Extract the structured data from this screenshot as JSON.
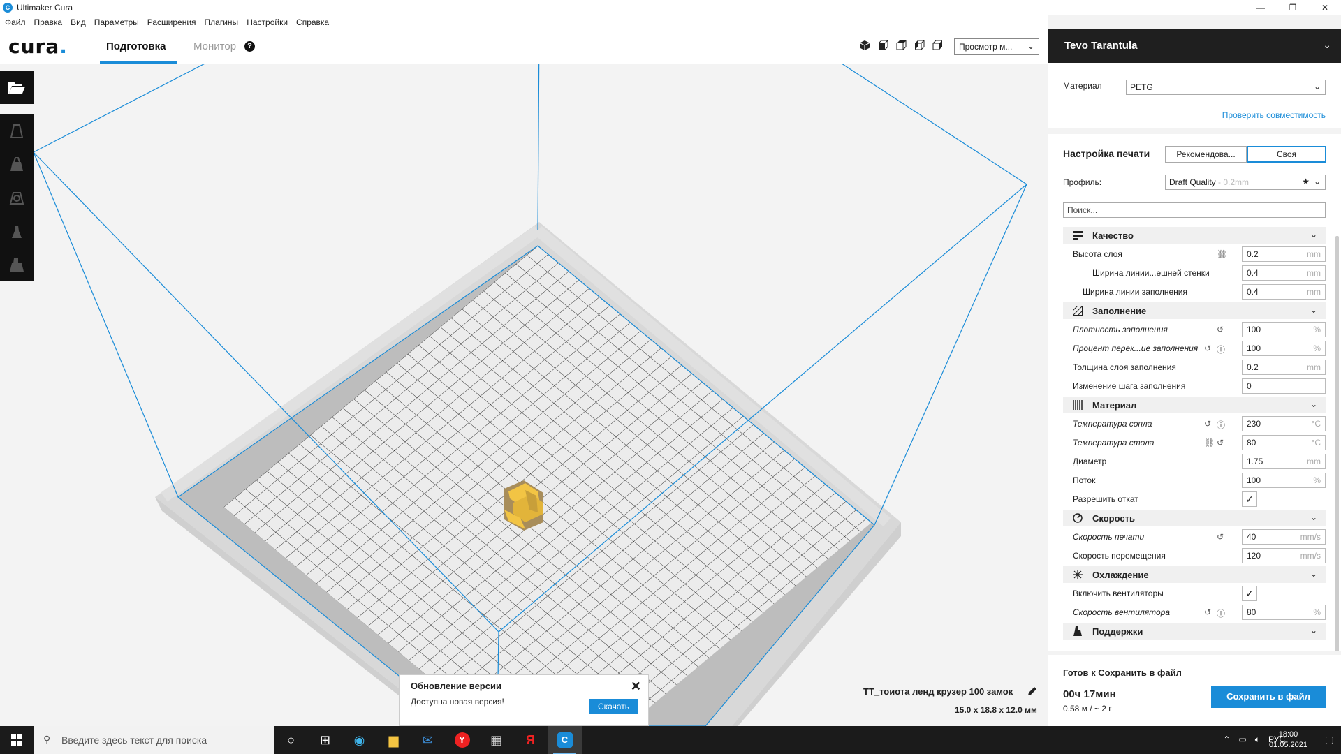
{
  "window": {
    "title": "Ultimaker Cura",
    "minimize": "—",
    "maximize": "❐",
    "close": "✕"
  },
  "menu": [
    "Файл",
    "Правка",
    "Вид",
    "Параметры",
    "Расширения",
    "Плагины",
    "Настройки",
    "Справка"
  ],
  "header": {
    "logo": "cura",
    "logo_dot": ".",
    "tab_prepare": "Подготовка",
    "tab_monitor": "Монитор",
    "help_icon": "?",
    "view_select": "Просмотр м...",
    "view_icons": [
      "3d-view-icon",
      "front-view-icon",
      "top-view-icon",
      "left-view-icon",
      "right-view-icon"
    ]
  },
  "viewport": {
    "object_name": "TT_тоиота ленд крузер 100 замок",
    "object_size": "15.0 x 18.8 x 12.0 мм",
    "model_color": "#f2c444",
    "accent": "#1a8cd8"
  },
  "update": {
    "title": "Обновление версии",
    "body": "Доступна новая версия!",
    "button": "Скачать"
  },
  "panel": {
    "printer": "Tevo Tarantula",
    "material_label": "Материал",
    "material_value": "PETG",
    "compat_link": "Проверить совместимость",
    "print_setup": "Настройка печати",
    "mode_recommended": "Рекомендова...",
    "mode_custom": "Своя",
    "profile_label": "Профиль:",
    "profile_value": "Draft Quality",
    "profile_sub": "- 0.2mm",
    "search_placeholder": "Поиск...",
    "settings": [
      {
        "type": "cat",
        "label": "Качество",
        "icon": "quality-icon"
      },
      {
        "type": "set",
        "label": "Высота слоя",
        "value": "0.2",
        "unit": "mm",
        "indent": 14,
        "italic": false,
        "icons": [
          "link"
        ]
      },
      {
        "type": "set",
        "label": "Ширина линии...ешней стенки",
        "value": "0.4",
        "unit": "mm",
        "indent": 42,
        "italic": false,
        "icons": []
      },
      {
        "type": "set",
        "label": "Ширина линии заполнения",
        "value": "0.4",
        "unit": "mm",
        "indent": 28,
        "italic": false,
        "icons": []
      },
      {
        "type": "cat",
        "label": "Заполнение",
        "icon": "infill-icon"
      },
      {
        "type": "set",
        "label": "Плотность заполнения",
        "value": "100",
        "unit": "%",
        "indent": 14,
        "italic": true,
        "icons": [
          "reset"
        ]
      },
      {
        "type": "set",
        "label": "Процент перек...ие заполнения",
        "value": "100",
        "unit": "%",
        "indent": 14,
        "italic": true,
        "icons": [
          "reset",
          "info"
        ]
      },
      {
        "type": "set",
        "label": "Толщина слоя заполнения",
        "value": "0.2",
        "unit": "mm",
        "indent": 14,
        "italic": false,
        "icons": []
      },
      {
        "type": "set",
        "label": "Изменение шага заполнения",
        "value": "0",
        "unit": "",
        "indent": 14,
        "italic": false,
        "icons": []
      },
      {
        "type": "cat",
        "label": "Материал",
        "icon": "material-icon"
      },
      {
        "type": "set",
        "label": "Температура сопла",
        "value": "230",
        "unit": "°C",
        "indent": 14,
        "italic": true,
        "icons": [
          "reset",
          "info"
        ]
      },
      {
        "type": "set",
        "label": "Температура стола",
        "value": "80",
        "unit": "°C",
        "indent": 14,
        "italic": true,
        "icons": [
          "link",
          "reset"
        ]
      },
      {
        "type": "set",
        "label": "Диаметр",
        "value": "1.75",
        "unit": "mm",
        "indent": 14,
        "italic": false,
        "icons": []
      },
      {
        "type": "set",
        "label": "Поток",
        "value": "100",
        "unit": "%",
        "indent": 14,
        "italic": false,
        "icons": []
      },
      {
        "type": "chk",
        "label": "Разрешить откат",
        "value": "✓",
        "indent": 14,
        "italic": false,
        "icons": []
      },
      {
        "type": "cat",
        "label": "Скорость",
        "icon": "speed-icon"
      },
      {
        "type": "set",
        "label": "Скорость печати",
        "value": "40",
        "unit": "mm/s",
        "indent": 14,
        "italic": true,
        "icons": [
          "reset"
        ]
      },
      {
        "type": "set",
        "label": "Скорость перемещения",
        "value": "120",
        "unit": "mm/s",
        "indent": 14,
        "italic": false,
        "icons": []
      },
      {
        "type": "cat",
        "label": "Охлаждение",
        "icon": "cooling-icon"
      },
      {
        "type": "chk",
        "label": "Включить вентиляторы",
        "value": "✓",
        "indent": 14,
        "italic": false,
        "icons": []
      },
      {
        "type": "set",
        "label": "Скорость вентилятора",
        "value": "80",
        "unit": "%",
        "indent": 14,
        "italic": true,
        "icons": [
          "reset",
          "info"
        ]
      },
      {
        "type": "cat",
        "label": "Поддержки",
        "icon": "support-icon"
      }
    ],
    "ready": "Готов к Сохранить в файл",
    "time": "00ч 17мин",
    "amount": "0.58 м / ~ 2 г",
    "save_button": "Сохранить в файл"
  },
  "taskbar": {
    "search_placeholder": "Введите здесь текст для поиска",
    "lang": "РУС",
    "time": "18:00",
    "date": "01.05.2021"
  }
}
